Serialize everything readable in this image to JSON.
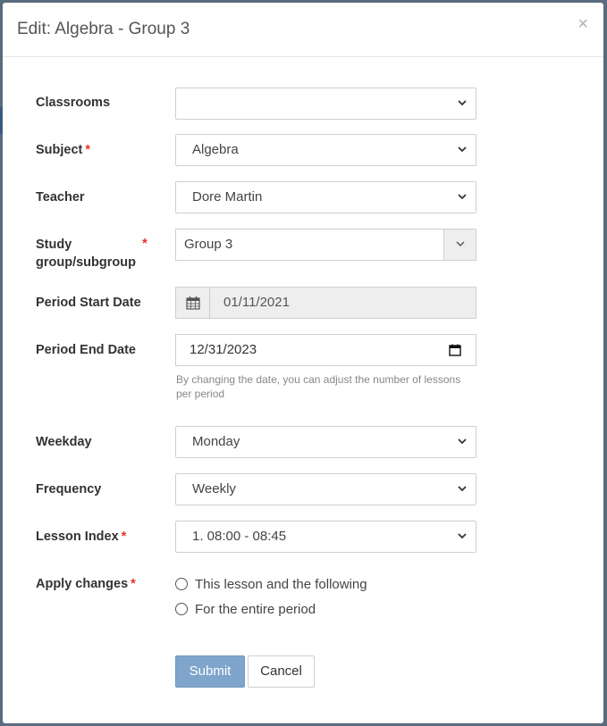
{
  "modal": {
    "title": "Edit: Algebra - Group 3",
    "close_symbol": "×"
  },
  "fields": {
    "classrooms": {
      "label": "Classrooms",
      "value": ""
    },
    "subject": {
      "label": "Subject",
      "required_mark": "*",
      "value": "Algebra"
    },
    "teacher": {
      "label": "Teacher",
      "value": "Dore Martin"
    },
    "study_group": {
      "label_line1": "Study",
      "label_line2": "group/subgroup",
      "required_mark": "*",
      "value": "Group 3"
    },
    "period_start": {
      "label": "Period Start Date",
      "value": "01/11/2021",
      "icon": "calendar-icon"
    },
    "period_end": {
      "label": "Period End Date",
      "value": "12/31/2023",
      "help_text": "By changing the date, you can adjust the number of lessons per period"
    },
    "weekday": {
      "label": "Weekday",
      "value": "Monday"
    },
    "frequency": {
      "label": "Frequency",
      "value": "Weekly"
    },
    "lesson_index": {
      "label": "Lesson Index",
      "required_mark": "*",
      "value": "1. 08:00 - 08:45"
    },
    "apply_changes": {
      "label": "Apply changes",
      "required_mark": "*",
      "options": [
        "This lesson and the following",
        "For the entire period"
      ]
    }
  },
  "buttons": {
    "submit": "Submit",
    "cancel": "Cancel"
  },
  "colors": {
    "required": "#e63329",
    "submit_bg": "#7fa5cc",
    "disabled_bg": "#eeeeee"
  }
}
